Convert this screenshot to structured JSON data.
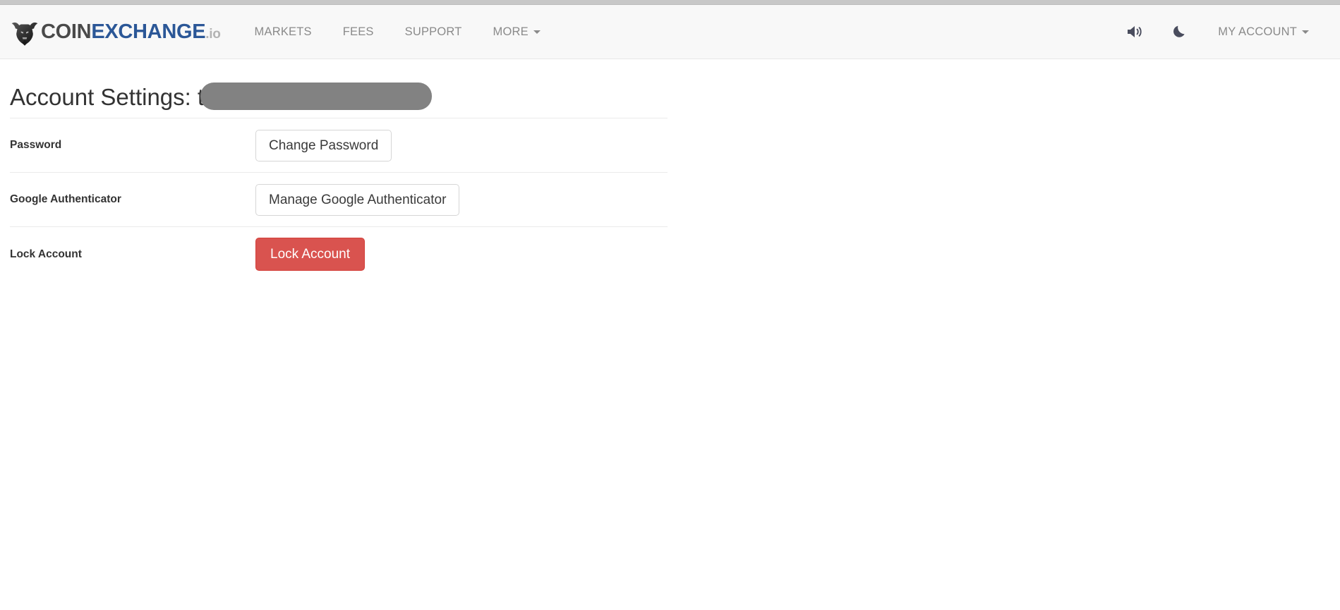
{
  "brand": {
    "logo_icon": "bull-head-icon",
    "name_part1": "COIN",
    "name_part2": "EXCHANGE",
    "name_tld": ".io",
    "color_primary": "#2b5797",
    "color_secondary": "#4a4a4a",
    "color_tld": "#b3b3b3"
  },
  "nav": {
    "links": [
      {
        "label": "MARKETS",
        "has_caret": false
      },
      {
        "label": "FEES",
        "has_caret": false
      },
      {
        "label": "SUPPORT",
        "has_caret": false
      },
      {
        "label": "MORE",
        "has_caret": true
      }
    ],
    "right": {
      "sound_icon": "speaker-volume-icon",
      "theme_icon": "moon-icon",
      "account_label": "MY ACCOUNT"
    }
  },
  "page": {
    "title_prefix": "Account Settings:",
    "username_visible": "t",
    "username_redacted": true,
    "redaction_color": "#828282"
  },
  "settings": {
    "rows": [
      {
        "label": "Password",
        "action_label": "Change Password",
        "action_style": "default"
      },
      {
        "label": "Google Authenticator",
        "action_label": "Manage Google Authenticator",
        "action_style": "default"
      },
      {
        "label": "Lock Account",
        "action_label": "Lock Account",
        "action_style": "danger"
      }
    ],
    "danger_color": "#d9534f"
  }
}
